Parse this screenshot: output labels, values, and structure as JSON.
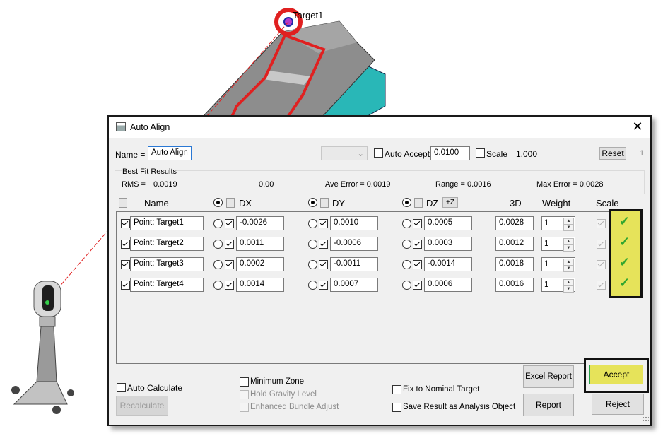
{
  "scene": {
    "target_label": "Target1"
  },
  "dialog": {
    "title": "Auto Align",
    "close_glyph": "✕",
    "name_label": "Name =",
    "name_value": "Auto Align",
    "auto_accept_label": "Auto Accept",
    "auto_accept_value": "0.0100",
    "scale_label": "Scale =",
    "scale_value": "1.000",
    "reset_label": "Reset",
    "corner_number": "1",
    "results": {
      "title": "Best Fit Results",
      "rms_label": "RMS =",
      "rms_value": "0.0019",
      "partial_label": "0.00",
      "ave_error": "Ave Error =  0.0019",
      "range": "Range =  0.0016",
      "max_error": "Max Error =  0.0028"
    },
    "columns": {
      "name": "Name",
      "dx": "DX",
      "dy": "DY",
      "dz": "DZ",
      "dz_toggle": "+Z",
      "d3": "3D",
      "weight": "Weight",
      "scale": "Scale"
    },
    "rows": [
      {
        "name": "Point: Target1",
        "dx": "-0.0026",
        "dy": "0.0010",
        "dz": "0.0005",
        "d3": "0.0028",
        "weight": "1"
      },
      {
        "name": "Point: Target2",
        "dx": "0.0011",
        "dy": "-0.0006",
        "dz": "0.0003",
        "d3": "0.0012",
        "weight": "1"
      },
      {
        "name": "Point: Target3",
        "dx": "0.0002",
        "dy": "-0.0011",
        "dz": "-0.0014",
        "d3": "0.0018",
        "weight": "1"
      },
      {
        "name": "Point: Target4",
        "dx": "0.0014",
        "dy": "0.0007",
        "dz": "0.0006",
        "d3": "0.0016",
        "weight": "1"
      }
    ],
    "scale_tick": "✓",
    "options": {
      "auto_calculate": "Auto Calculate",
      "recalculate": "Recalculate",
      "minimum_zone": "Minimum Zone",
      "hold_gravity": "Hold Gravity Level",
      "enhanced_bundle": "Enhanced Bundle Adjust",
      "fix_nominal": "Fix to Nominal Target",
      "save_result": "Save Result as Analysis Object"
    },
    "buttons": {
      "excel_report": "Excel Report",
      "report": "Report",
      "accept": "Accept",
      "reject": "Reject"
    },
    "colors": {
      "highlight": "#e6e35a",
      "tick": "#2fa52f",
      "fixture": "#29b7b7",
      "laser": "#e02020"
    }
  }
}
